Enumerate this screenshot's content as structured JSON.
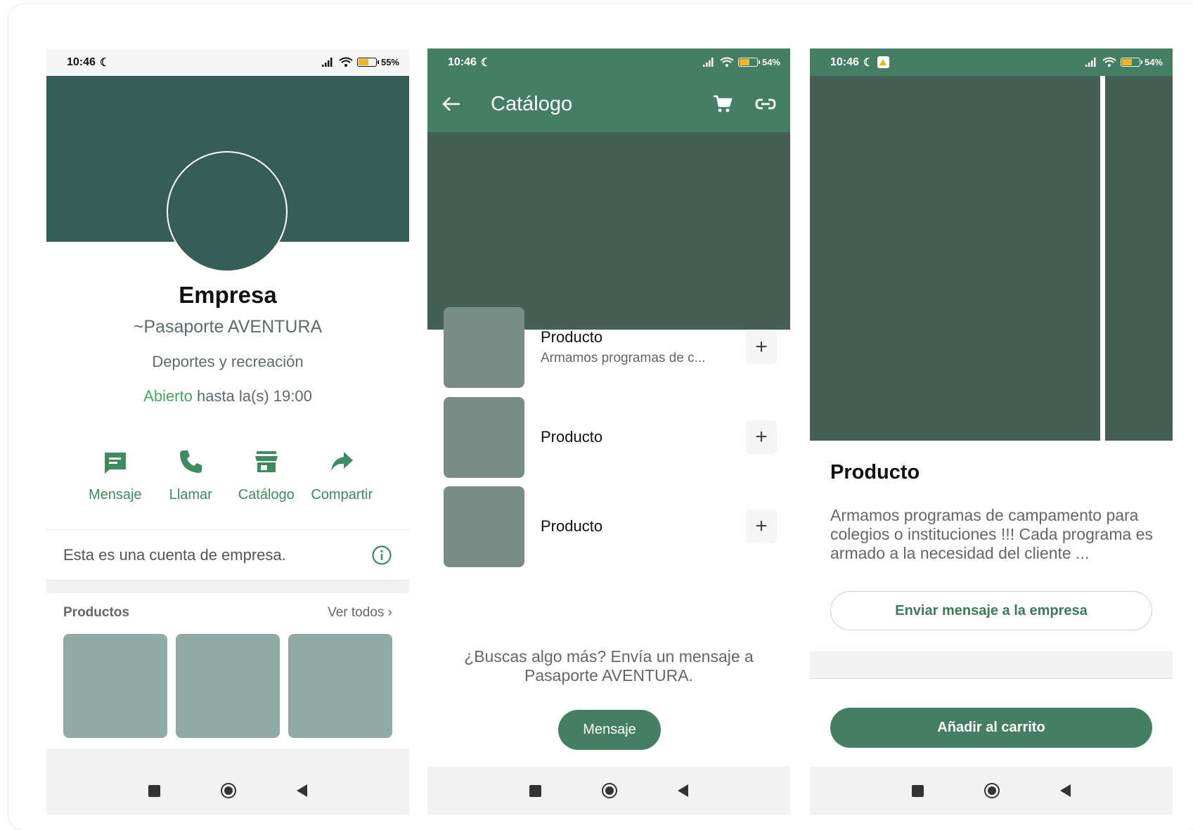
{
  "screens": {
    "profile": {
      "status": {
        "time": "10:46",
        "battery": "55%"
      },
      "name": "Empresa",
      "subtitle": "~Pasaporte AVENTURA",
      "category": "Deportes y recreación",
      "hours_open": "Abierto",
      "hours_rest": " hasta la(s) 19:00",
      "actions": [
        {
          "label": "Mensaje",
          "icon": "message-icon"
        },
        {
          "label": "Llamar",
          "icon": "phone-icon"
        },
        {
          "label": "Catálogo",
          "icon": "store-icon"
        },
        {
          "label": "Compartir",
          "icon": "share-icon"
        }
      ],
      "info_text": "Esta es una cuenta de empresa.",
      "products_title": "Productos",
      "see_all": "Ver todos"
    },
    "catalog": {
      "status": {
        "time": "10:46",
        "battery": "54%"
      },
      "title": "Catálogo",
      "items": [
        {
          "name": "Producto",
          "desc": "Armamos programas de c..."
        },
        {
          "name": "Producto",
          "desc": ""
        },
        {
          "name": "Producto",
          "desc": ""
        }
      ],
      "more_text_1": "¿Buscas algo más? Envía un mensaje a",
      "more_text_2": "Pasaporte AVENTURA.",
      "message_button": "Mensaje"
    },
    "product": {
      "status": {
        "time": "10:46",
        "battery": "54%"
      },
      "title": "Producto",
      "description": "Armamos programas de campamento para colegios o instituciones !!! Cada programa es armado a la necesidad del cliente ...",
      "send_message_button": "Enviar mensaje a la empresa",
      "add_to_cart_button": "Añadir al carrito"
    }
  },
  "colors": {
    "accent": "#447e64",
    "cover": "#345e56",
    "open": "#4aa55a"
  },
  "battery_levels": {
    "profile": 0.55,
    "catalog": 0.54,
    "product": 0.54
  }
}
